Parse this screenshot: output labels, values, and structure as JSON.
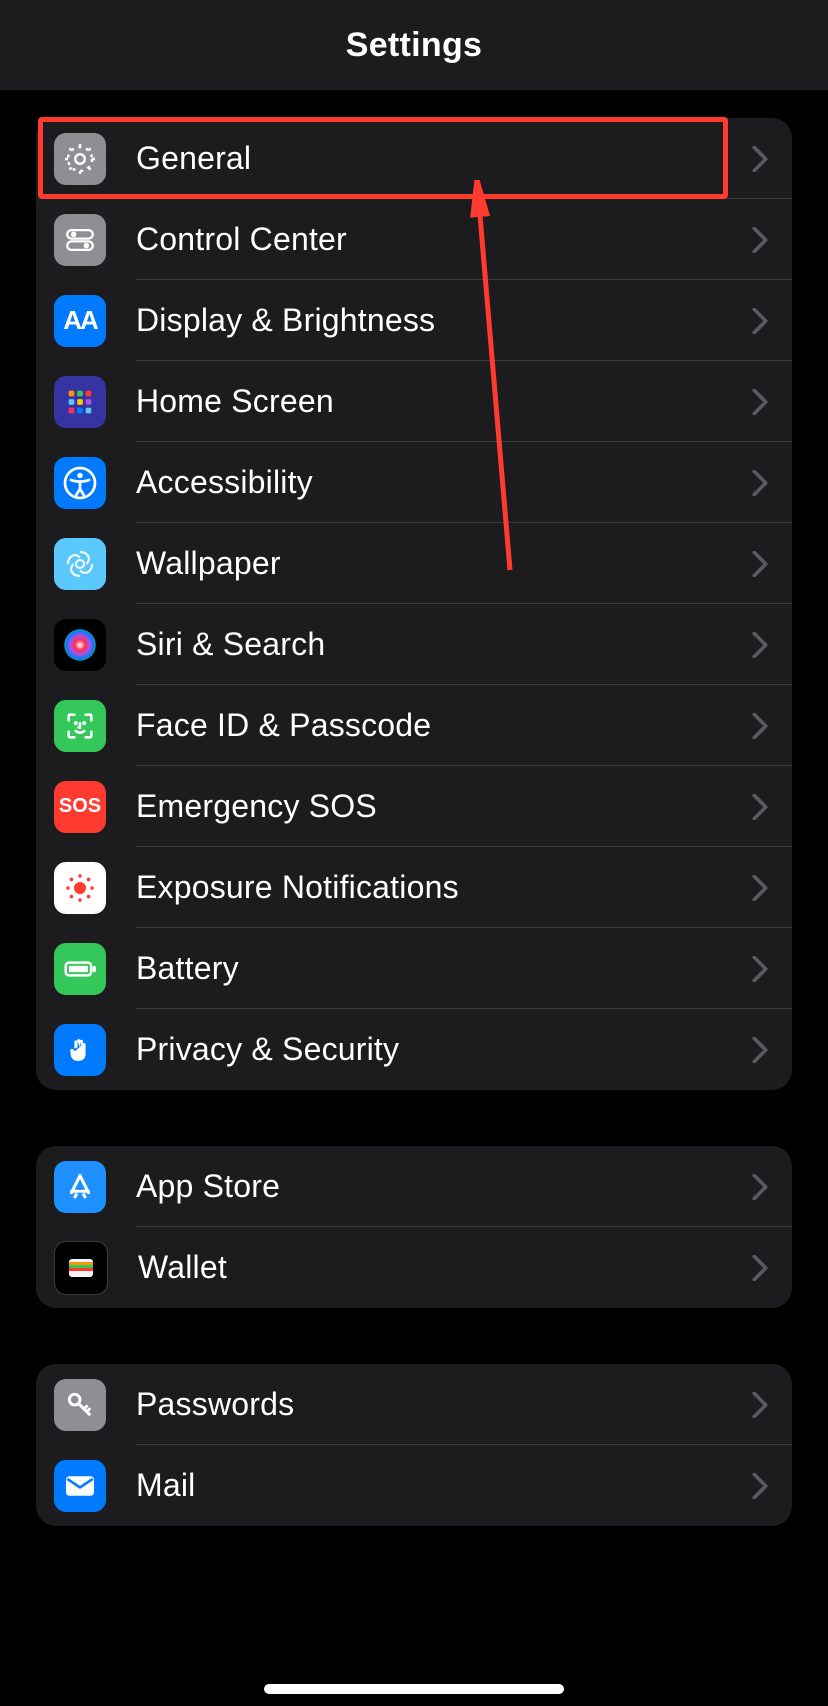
{
  "header": {
    "title": "Settings"
  },
  "groups": [
    {
      "items": [
        {
          "id": "general",
          "label": "General"
        },
        {
          "id": "control-center",
          "label": "Control Center"
        },
        {
          "id": "display-brightness",
          "label": "Display & Brightness"
        },
        {
          "id": "home-screen",
          "label": "Home Screen"
        },
        {
          "id": "accessibility",
          "label": "Accessibility"
        },
        {
          "id": "wallpaper",
          "label": "Wallpaper"
        },
        {
          "id": "siri-search",
          "label": "Siri & Search"
        },
        {
          "id": "face-id-passcode",
          "label": "Face ID & Passcode"
        },
        {
          "id": "emergency-sos",
          "label": "Emergency SOS"
        },
        {
          "id": "exposure-notifications",
          "label": "Exposure Notifications"
        },
        {
          "id": "battery",
          "label": "Battery"
        },
        {
          "id": "privacy-security",
          "label": "Privacy & Security"
        }
      ]
    },
    {
      "items": [
        {
          "id": "app-store",
          "label": "App Store"
        },
        {
          "id": "wallet",
          "label": "Wallet"
        }
      ]
    },
    {
      "items": [
        {
          "id": "passwords",
          "label": "Passwords"
        },
        {
          "id": "mail",
          "label": "Mail"
        }
      ]
    }
  ],
  "annotations": {
    "highlight": {
      "target": "general",
      "color": "#ff3b30"
    },
    "arrow": {
      "color": "#ff3b30"
    }
  },
  "colors": {
    "bg": "#000000",
    "group": "#1c1c1e",
    "text": "#ffffff",
    "separator": "#3a3a3c",
    "blue": "#007aff",
    "green": "#34c759",
    "red": "#ff3b30",
    "gray": "#8e8e93",
    "cyan": "#5ac8fa"
  },
  "sos_label": "SOS",
  "aa_label": "AA"
}
